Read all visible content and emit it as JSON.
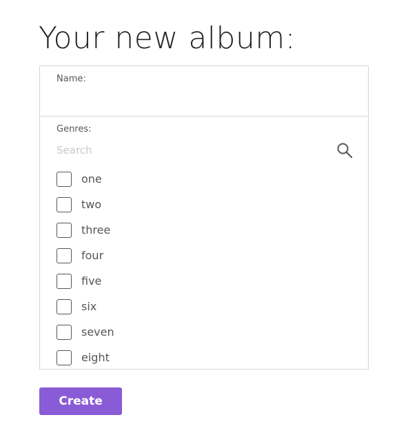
{
  "page": {
    "title": "Your new album:"
  },
  "form": {
    "name": {
      "label": "Name:",
      "value": ""
    },
    "genres": {
      "label": "Genres:",
      "search_placeholder": "Search",
      "search_icon": "search-icon",
      "options": [
        {
          "label": "one",
          "checked": false
        },
        {
          "label": "two",
          "checked": false
        },
        {
          "label": "three",
          "checked": false
        },
        {
          "label": "four",
          "checked": false
        },
        {
          "label": "five",
          "checked": false
        },
        {
          "label": "six",
          "checked": false
        },
        {
          "label": "seven",
          "checked": false
        },
        {
          "label": "eight",
          "checked": false
        }
      ]
    },
    "create_label": "Create"
  },
  "colors": {
    "accent": "#8a5bd6",
    "border": "#d6d6d6",
    "text": "#555555",
    "placeholder": "#c8c8c8"
  }
}
